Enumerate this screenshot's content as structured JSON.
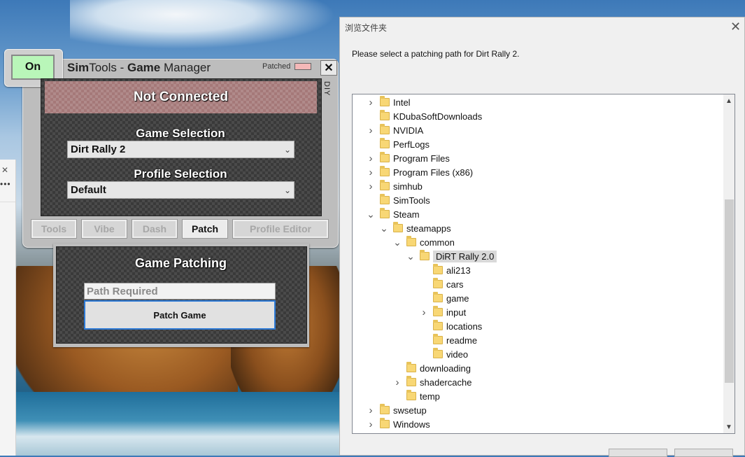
{
  "simtools": {
    "on_label": "On",
    "title_part1": "Sim",
    "title_part2": "Tools - ",
    "title_part3": "Game",
    "title_part4": " Manager",
    "patched_label": "Patched",
    "close_label": "✕",
    "diy_label": "DIY",
    "status": "Not Connected",
    "game_selection_label": "Game Selection",
    "game_selected": "Dirt Rally 2",
    "profile_selection_label": "Profile Selection",
    "profile_selected": "Default",
    "tabs": [
      "Tools",
      "Vibe",
      "Dash",
      "Patch",
      "Profile Editor"
    ],
    "active_tab": "Patch"
  },
  "game_patching": {
    "title": "Game Patching",
    "path_placeholder": "Path Required",
    "patch_button": "Patch Game"
  },
  "dialog": {
    "title": "浏览文件夹",
    "message": "Please select a patching path for Dirt Rally 2.",
    "tree": [
      {
        "label": "Intel",
        "expander": "collapsed"
      },
      {
        "label": "KDubaSoftDownloads",
        "expander": "none"
      },
      {
        "label": "NVIDIA",
        "expander": "collapsed"
      },
      {
        "label": "PerfLogs",
        "expander": "none"
      },
      {
        "label": "Program Files",
        "expander": "collapsed"
      },
      {
        "label": "Program Files (x86)",
        "expander": "collapsed"
      },
      {
        "label": "simhub",
        "expander": "collapsed"
      },
      {
        "label": "SimTools",
        "expander": "none"
      },
      {
        "label": "Steam",
        "expander": "expanded"
      },
      {
        "label": "steamapps",
        "expander": "expanded"
      },
      {
        "label": "common",
        "expander": "expanded"
      },
      {
        "label": "DiRT Rally 2.0",
        "expander": "expanded",
        "selected": true
      },
      {
        "label": "ali213",
        "expander": "none"
      },
      {
        "label": "cars",
        "expander": "none"
      },
      {
        "label": "game",
        "expander": "none"
      },
      {
        "label": "input",
        "expander": "collapsed"
      },
      {
        "label": "locations",
        "expander": "none"
      },
      {
        "label": "readme",
        "expander": "none"
      },
      {
        "label": "video",
        "expander": "none"
      },
      {
        "label": "downloading",
        "expander": "none"
      },
      {
        "label": "shadercache",
        "expander": "collapsed"
      },
      {
        "label": "temp",
        "expander": "none"
      },
      {
        "label": "swsetup",
        "expander": "collapsed"
      },
      {
        "label": "Windows",
        "expander": "collapsed"
      }
    ]
  },
  "icons": {
    "close": "close-icon",
    "folder": "folder-icon",
    "chevron_right": "chevron-right-icon",
    "chevron_down": "chevron-down-icon"
  }
}
